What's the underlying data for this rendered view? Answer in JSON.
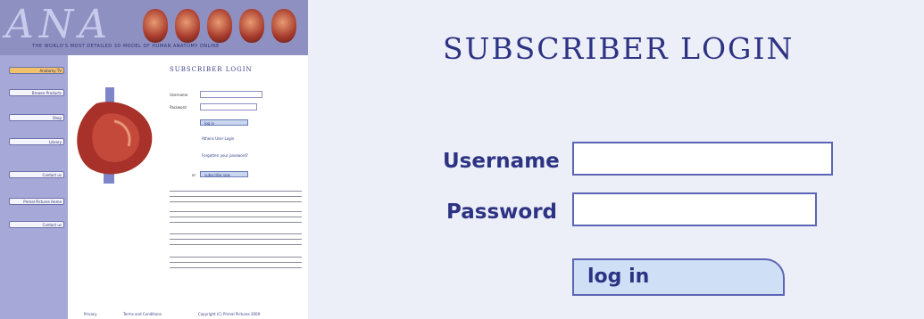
{
  "thumbnail": {
    "banner_logo": "ANA",
    "banner_tagline": "THE WORLD'S MOST DETAILED 3D MODEL OF HUMAN ANATOMY ONLINE",
    "sidebar_items": [
      "Anatomy TV",
      "Browse Products",
      "Shop",
      "Library",
      "Contact us",
      "Primal Pictures Home",
      "Contact us"
    ],
    "title": "SUBSCRIBER LOGIN",
    "username_label": "Username",
    "password_label": "Password",
    "login_label": "log in",
    "athens_link": "Athens User Login",
    "forgot_link": "Forgotten your password?",
    "or_label": "or",
    "subscribe_label": "subscribe now",
    "footer": {
      "privacy": "Privacy",
      "terms": "Terms and Conditions",
      "copyright": "Copyright (C) Primal Pictures 2009"
    }
  },
  "login": {
    "title": "SUBSCRIBER LOGIN",
    "username_label": "Username",
    "password_label": "Password",
    "username_value": "",
    "password_value": "",
    "button_label": "log in"
  },
  "colors": {
    "brand_navy": "#2d3383",
    "field_border": "#5c64b4",
    "button_fill": "#cfe0f6",
    "background": "#eceef8"
  }
}
